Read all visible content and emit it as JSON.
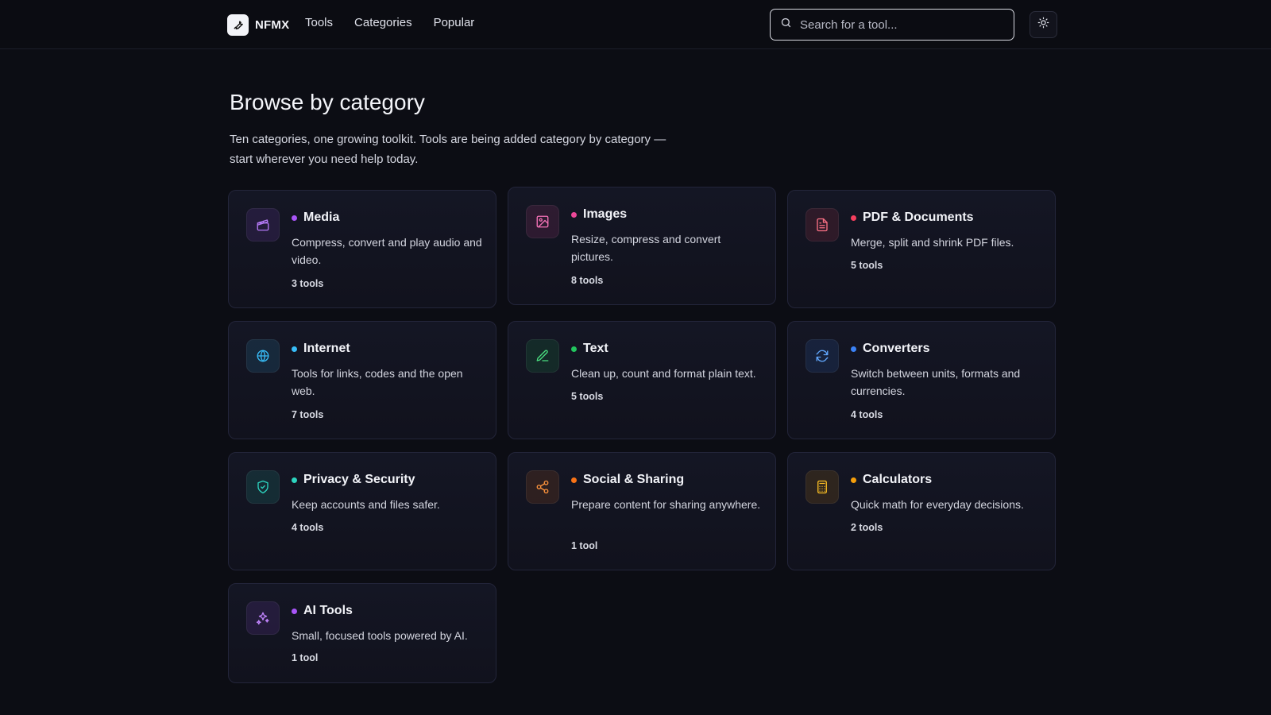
{
  "header": {
    "brand": "NFMX",
    "nav": [
      "Tools",
      "Categories",
      "Popular"
    ],
    "search_placeholder": "Search for a tool..."
  },
  "main": {
    "title": "Browse by category",
    "description": "Ten categories, one growing toolkit. Tools are being added category by category — start wherever you need help today."
  },
  "categories": [
    {
      "name": "Media",
      "description": "Compress, convert and play audio and video.",
      "count": "3 tools",
      "icon": "clapperboard-icon",
      "color": "#a855f7"
    },
    {
      "name": "Images",
      "description": "Resize, compress and convert pictures.",
      "count": "8 tools",
      "icon": "image-icon",
      "color": "#ec4899"
    },
    {
      "name": "PDF & Documents",
      "description": "Merge, split and shrink PDF files.",
      "count": "5 tools",
      "icon": "file-text-icon",
      "color": "#f43f5e"
    },
    {
      "name": "Internet",
      "description": "Tools for links, codes and the open web.",
      "count": "7 tools",
      "icon": "globe-icon",
      "color": "#38bdf8"
    },
    {
      "name": "Text",
      "description": "Clean up, count and format plain text.",
      "count": "5 tools",
      "icon": "pen-icon",
      "color": "#22c55e"
    },
    {
      "name": "Converters",
      "description": "Switch between units, formats and currencies.",
      "count": "4 tools",
      "icon": "refresh-icon",
      "color": "#3b82f6"
    },
    {
      "name": "Privacy & Security",
      "description": "Keep accounts and files safer.",
      "count": "4 tools",
      "icon": "shield-check-icon",
      "color": "#2dd4bf"
    },
    {
      "name": "Social & Sharing",
      "description": "Prepare content for sharing anywhere.",
      "count": "1 tool",
      "icon": "share-icon",
      "color": "#f97316"
    },
    {
      "name": "Calculators",
      "description": "Quick math for everyday decisions.",
      "count": "2 tools",
      "icon": "calculator-icon",
      "color": "#f59e0b"
    },
    {
      "name": "AI Tools",
      "description": "Small, focused tools powered by AI.",
      "count": "1 tool",
      "icon": "sparkles-icon",
      "color": "#a855f7"
    }
  ]
}
